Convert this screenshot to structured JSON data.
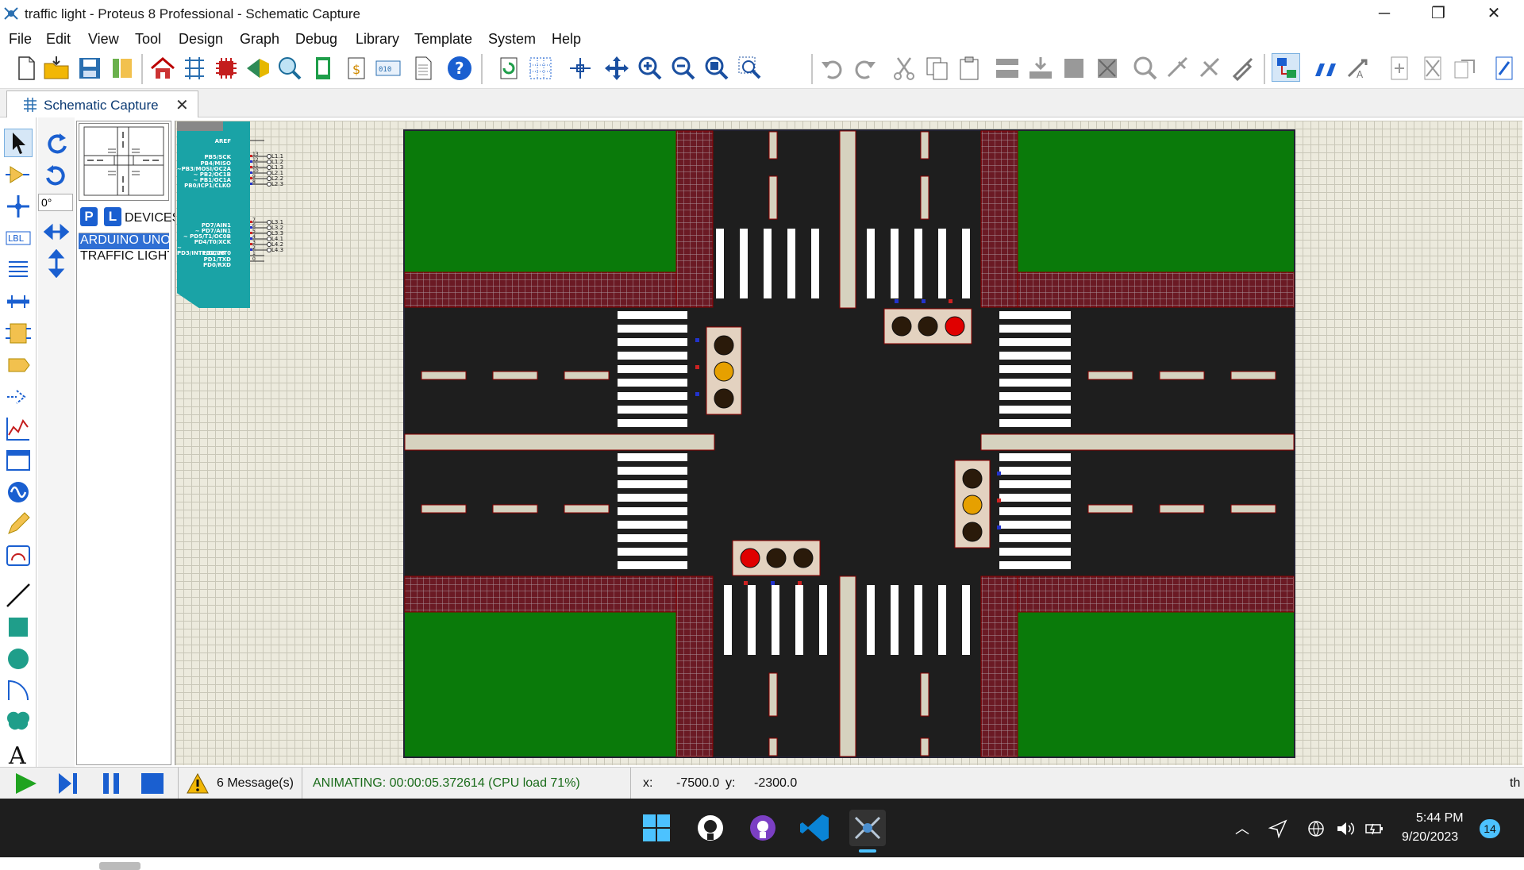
{
  "window": {
    "title": "traffic light - Proteus 8 Professional - Schematic Capture",
    "controls": [
      "minimize",
      "restore",
      "close"
    ]
  },
  "menu": [
    "File",
    "Edit",
    "View",
    "Tool",
    "Design",
    "Graph",
    "Debug",
    "Library",
    "Template",
    "System",
    "Help"
  ],
  "tab": {
    "label": "Schematic Capture",
    "close": "✕"
  },
  "rotation": {
    "angle": "0°"
  },
  "device_panel": {
    "p_button": "P",
    "l_button": "L",
    "header": "DEVICES",
    "items": [
      {
        "label": "ARDUINO UNO",
        "selected": true
      },
      {
        "label": "TRAFFIC LIGHT",
        "selected": false
      }
    ]
  },
  "arduino": {
    "pins_top": [
      "AREF",
      "PB5/SCK",
      "PB4/MISO",
      "~PB3/MOSI/OC2A",
      "~ PB2/OC1B",
      "~ PB1/OC1A",
      "PB0/ICP1/CLKO"
    ],
    "pins_bottom": [
      "PD7/AIN1",
      "~ PD7/AIN1",
      "~ PD5/T1/OC0B",
      "PD4/T0/XCK",
      "~ PD3/INT1/OC2B",
      "PD2/INT0",
      "PD1/TXD",
      "PD0/RXD"
    ],
    "pin_numbers_top": [
      "13",
      "12",
      "11",
      "10",
      "9",
      "8"
    ],
    "pin_numbers_bottom": [
      "7",
      "6",
      "5",
      "4",
      "3",
      "2",
      "1",
      "0"
    ],
    "labels_top": [
      "L1.1",
      "L1.2",
      "L1.3",
      "L2.1",
      "L2.2",
      "L2.3"
    ],
    "labels_bottom": [
      "L3.1",
      "L3.2",
      "L3.3",
      "L4.1",
      "L4.2",
      "L4.3"
    ]
  },
  "traffic_lights": [
    {
      "id": "north",
      "orientation": "horizontal",
      "states": [
        "off",
        "off",
        "red"
      ]
    },
    {
      "id": "west",
      "orientation": "vertical",
      "states": [
        "off",
        "yellow",
        "off"
      ]
    },
    {
      "id": "east",
      "orientation": "vertical",
      "states": [
        "off",
        "yellow",
        "off"
      ]
    },
    {
      "id": "south",
      "orientation": "horizontal",
      "states": [
        "red",
        "off",
        "off"
      ]
    }
  ],
  "status": {
    "messages": "6 Message(s)",
    "animating": "ANIMATING: 00:00:05.372614 (CPU load 71%)",
    "x_label": "x:",
    "x_value": "-7500.0",
    "y_label": "y:",
    "y_value": "-2300.0",
    "unit": "th"
  },
  "taskbar": {
    "time": "5:44 PM",
    "date": "9/20/2023",
    "notifications": "14"
  },
  "colors": {
    "grass": "#0a7a0a",
    "road": "#1e1e1e",
    "sidewalk": "#6b1a24",
    "median": "#d6d2bf",
    "arduino": "#1aa3a6",
    "light_red": "#e00000",
    "light_yellow": "#e6a000",
    "light_off": "#2a1a0a"
  }
}
